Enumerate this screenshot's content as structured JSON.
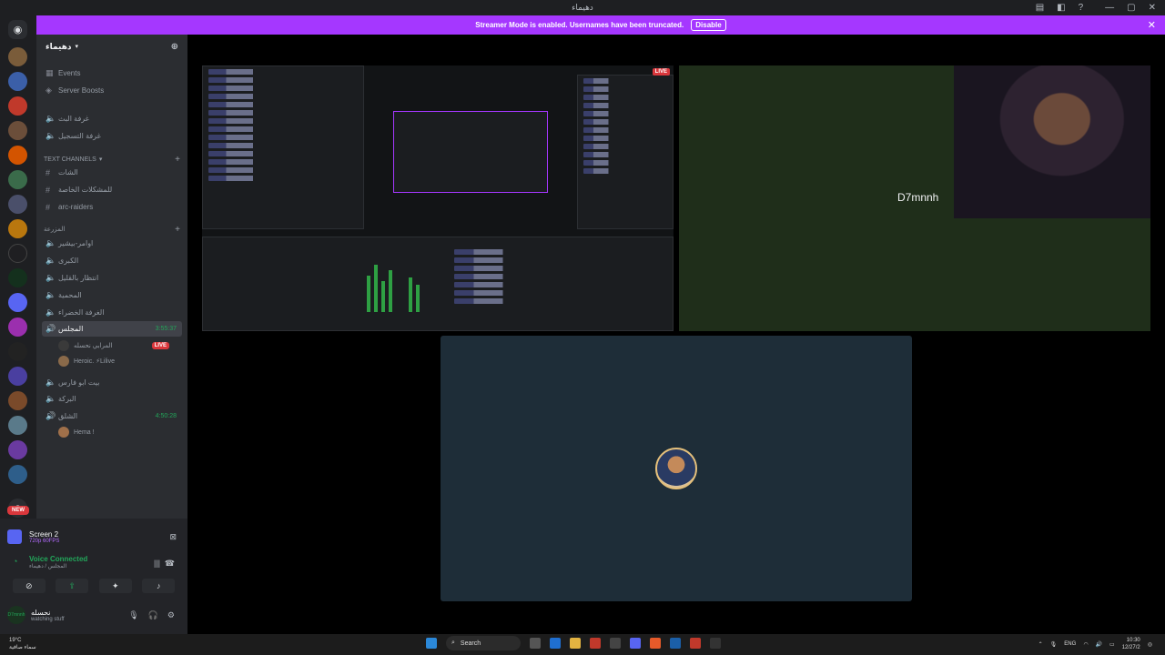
{
  "window": {
    "title": "دهيماء"
  },
  "banner": {
    "message": "Streamer Mode is enabled. Usernames have been truncated.",
    "disable_label": "Disable"
  },
  "server": {
    "name": "دهيماء"
  },
  "sidebar": {
    "top_items": [
      {
        "label": "Events",
        "icon": "calendar-icon"
      },
      {
        "label": "Server Boosts",
        "icon": "boost-icon"
      }
    ],
    "voice_top": [
      {
        "label": "غرفة البث"
      },
      {
        "label": "غرفة التسجيل"
      }
    ],
    "text_category": "Text Channels",
    "text_channels": [
      {
        "label": "الشات"
      },
      {
        "label": "للمشكلات الخاصة"
      },
      {
        "label": "arc-raiders"
      }
    ],
    "voice_category": "المزرعة",
    "voice_channels": [
      {
        "label": "اوامر-بيشير"
      },
      {
        "label": "الكبرى"
      },
      {
        "label": "انتظار بالقليل"
      },
      {
        "label": "المحمية"
      },
      {
        "label": "الغرفة الخضراء"
      }
    ],
    "active_channel": {
      "label": "المجلس",
      "timer": "3:55:37"
    },
    "active_users": [
      {
        "name": "المرابي نحسله",
        "live": "LIVE"
      },
      {
        "name": "Heroic. ⚡Lilive"
      }
    ],
    "more_channels": [
      {
        "label": "بيت ابو فارس"
      },
      {
        "label": "البركة"
      }
    ],
    "second_active": {
      "label": "الشلق",
      "timer": "4:50:28"
    },
    "second_users": [
      {
        "name": "Hema !"
      }
    ]
  },
  "rail": {
    "new_badge": "NEW",
    "letter": "S"
  },
  "bottom": {
    "screen_title": "Screen 2",
    "screen_sub": "720p 60FPS",
    "voice_status": "Voice Connected",
    "voice_channel": "المجلس / دهيماء",
    "user_name": "نحسله",
    "user_status": "watching stuff",
    "user_avatar_text": "D7mnnh"
  },
  "stage": {
    "cam_name": "D7mnnh",
    "live_label": "LIVE"
  },
  "taskbar": {
    "weather_temp": "19°C",
    "weather_desc": "سماء صافية",
    "search_label": "Search",
    "lang": "ENG",
    "time": "10:30",
    "date": "12/27/2"
  }
}
